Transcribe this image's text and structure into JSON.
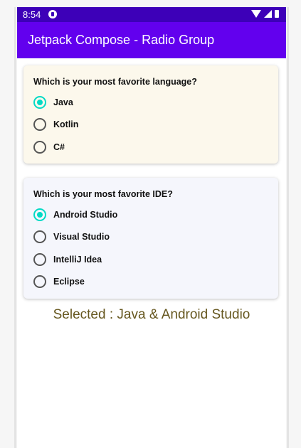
{
  "status_bar": {
    "time": "8:54",
    "color": "#3d00b8"
  },
  "app_bar": {
    "title": "Jetpack Compose - Radio Group",
    "color": "#6200ee"
  },
  "language_card": {
    "question": "Which is your most favorite language?",
    "background": "#fcf8ec",
    "options": [
      {
        "label": "Java",
        "selected": true
      },
      {
        "label": "Kotlin",
        "selected": false
      },
      {
        "label": "C#",
        "selected": false
      }
    ]
  },
  "ide_card": {
    "question": "Which is your most favorite IDE?",
    "background": "#f5f6fc",
    "options": [
      {
        "label": "Android Studio",
        "selected": true
      },
      {
        "label": "Visual Studio",
        "selected": false
      },
      {
        "label": "IntelliJ Idea",
        "selected": false
      },
      {
        "label": "Eclipse",
        "selected": false
      }
    ]
  },
  "result": {
    "text": "Selected : Java & Android Studio",
    "color": "#66571f"
  },
  "accent_color": "#03dac5",
  "icons": [
    "app-notification-icon",
    "wifi-icon",
    "signal-icon",
    "battery-icon"
  ]
}
